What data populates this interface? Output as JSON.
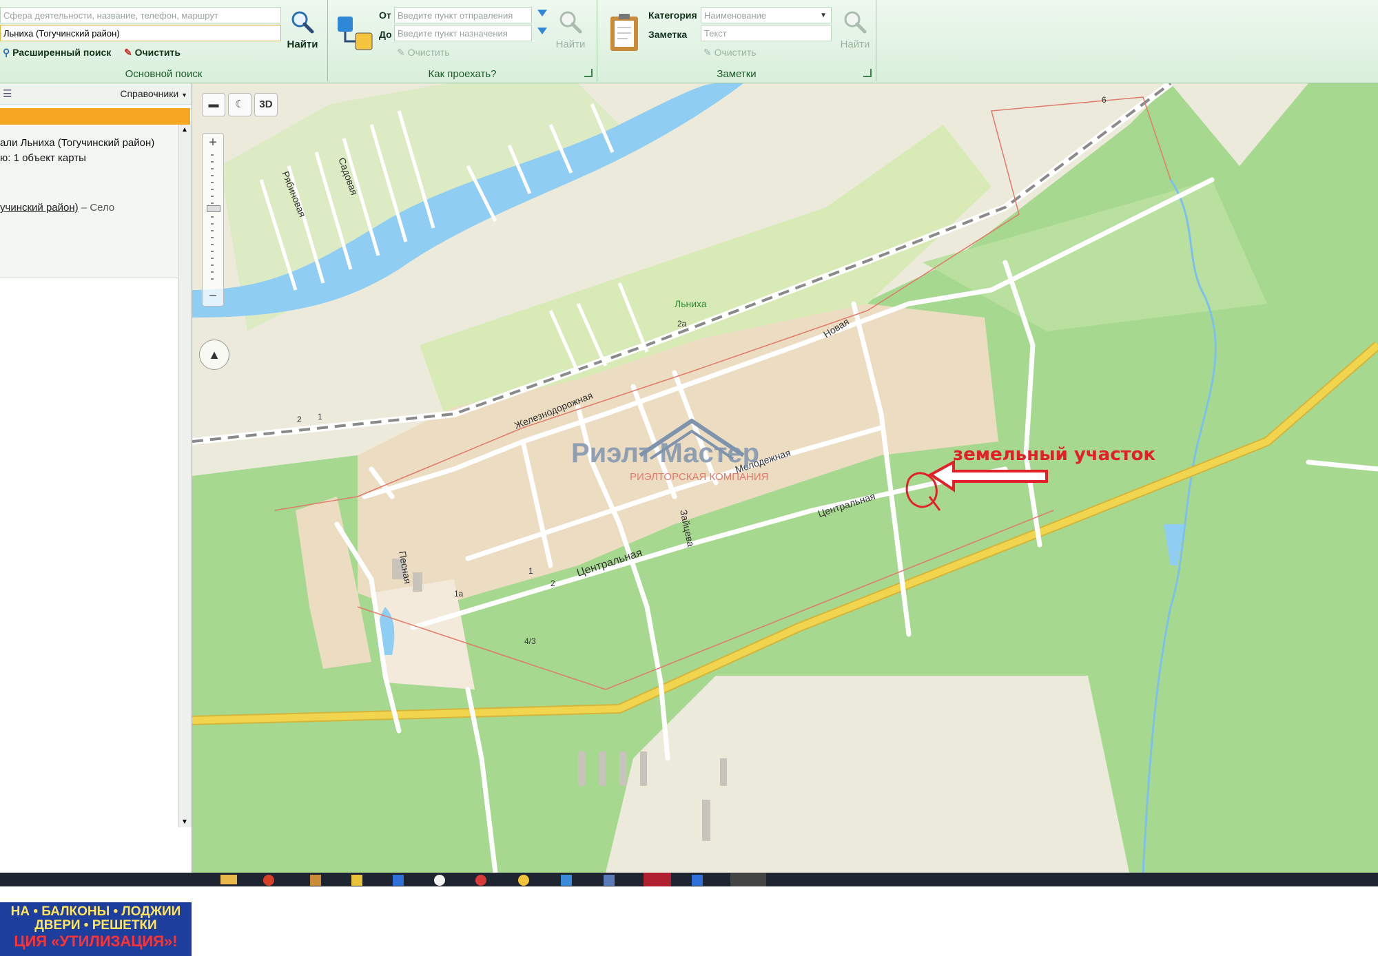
{
  "ribbon": {
    "main_search": {
      "query_placeholder": "Сфера деятельности, название, телефон, маршрут",
      "query_value": "Льниха (Тогучинский район)",
      "find_label": "Найти",
      "advanced_label": "Расширенный поиск",
      "clear_label": "Очистить",
      "group_title": "Основной поиск"
    },
    "route": {
      "from_label": "От",
      "to_label": "До",
      "from_placeholder": "Введите пункт отправления",
      "to_placeholder": "Введите пункт назначения",
      "find_label": "Найти",
      "clear_label": "Очистить",
      "group_title": "Как проехать?"
    },
    "notes": {
      "category_label": "Категория",
      "category_value": "Наименование",
      "note_label": "Заметка",
      "note_placeholder": "Текст",
      "find_label": "Найти",
      "clear_label": "Очистить",
      "group_title": "Заметки"
    }
  },
  "left_panel": {
    "directories_label": "Справочники",
    "result_title": "али Льниха (Тогучинский район)",
    "result_count": "ю: 1 объект карты",
    "result_link": "учинский район)",
    "result_type": " – Село",
    "promo_line1": "НА • БАЛКОНЫ • ЛОДЖИИ",
    "promo_line2": "ДВЕРИ • РЕШЕТКИ",
    "promo_line3": "ЦИЯ «УТИЛИЗАЦИЯ»!"
  },
  "map": {
    "controls": {
      "btn_3d": "3D"
    },
    "place_label": "Льниха",
    "streets": {
      "sadovaya": "Садовая",
      "ryabinovaya": "Рябиновая",
      "novaya": "Новая",
      "zheleznodorozhnaya": "Железнодорожная",
      "molodezhnaya": "Молодежная",
      "tsentralnaya_east": "Центральная",
      "tsentralnaya_west": "Центральная",
      "zaitseva": "Зайцева",
      "pesnaya": "Песная"
    },
    "house_numbers": {
      "h2a": "2а",
      "h2": "2",
      "h1": "1",
      "h1_b": "1",
      "h2_b": "2",
      "h1a": "1а",
      "h43": "4/3",
      "h6": "6"
    },
    "watermark_name": "Риэлт Мастер",
    "watermark_sub": "РИЭЛТОРСКАЯ КОМПАНИЯ",
    "annotation": "земельный участок",
    "colors": {
      "forest": "#a6d88f",
      "settlement": "#ecdcc2",
      "field": "#eceadb",
      "river": "#8fcdf2",
      "highway": "#f1d54f",
      "annotation": "#e2202a"
    }
  }
}
